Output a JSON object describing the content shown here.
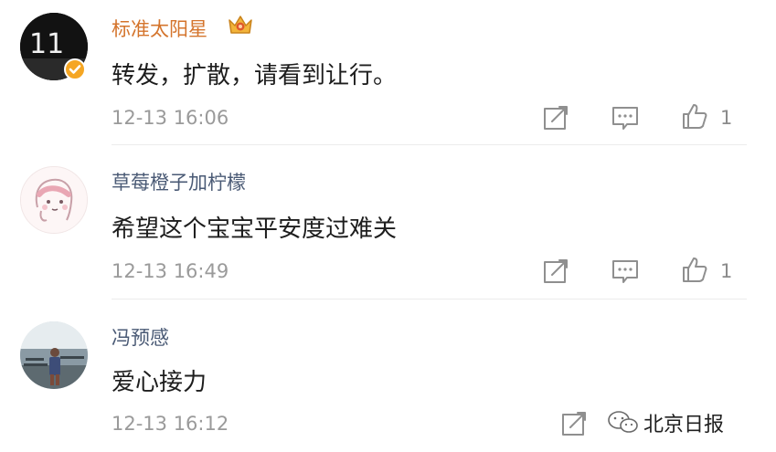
{
  "comments": [
    {
      "username": "标准太阳星",
      "avatar_label": "11",
      "text": "转发，扩散，请看到让行。",
      "time": "12-13 16:06",
      "likes": "1",
      "vip": true,
      "verified": true,
      "icons": [
        "crown-icon",
        "verified-badge-icon",
        "repost-icon",
        "comment-icon",
        "like-icon"
      ]
    },
    {
      "username": "草莓橙子加柠檬",
      "text": "希望这个宝宝平安度过难关",
      "time": "12-13 16:49",
      "likes": "1",
      "icons": [
        "repost-icon",
        "comment-icon",
        "like-icon"
      ]
    },
    {
      "username": "冯预感",
      "text": "爱心接力",
      "time": "12-13 16:12",
      "likes": "",
      "icons": [
        "repost-icon"
      ]
    }
  ],
  "watermark": {
    "text": "北京日报",
    "icon": "wechat-icon"
  },
  "colors": {
    "username": "#4a5a75",
    "vip_username": "#d4742c",
    "text": "#1d1d1d",
    "meta": "#9a9a9a",
    "divider": "#ececec"
  }
}
